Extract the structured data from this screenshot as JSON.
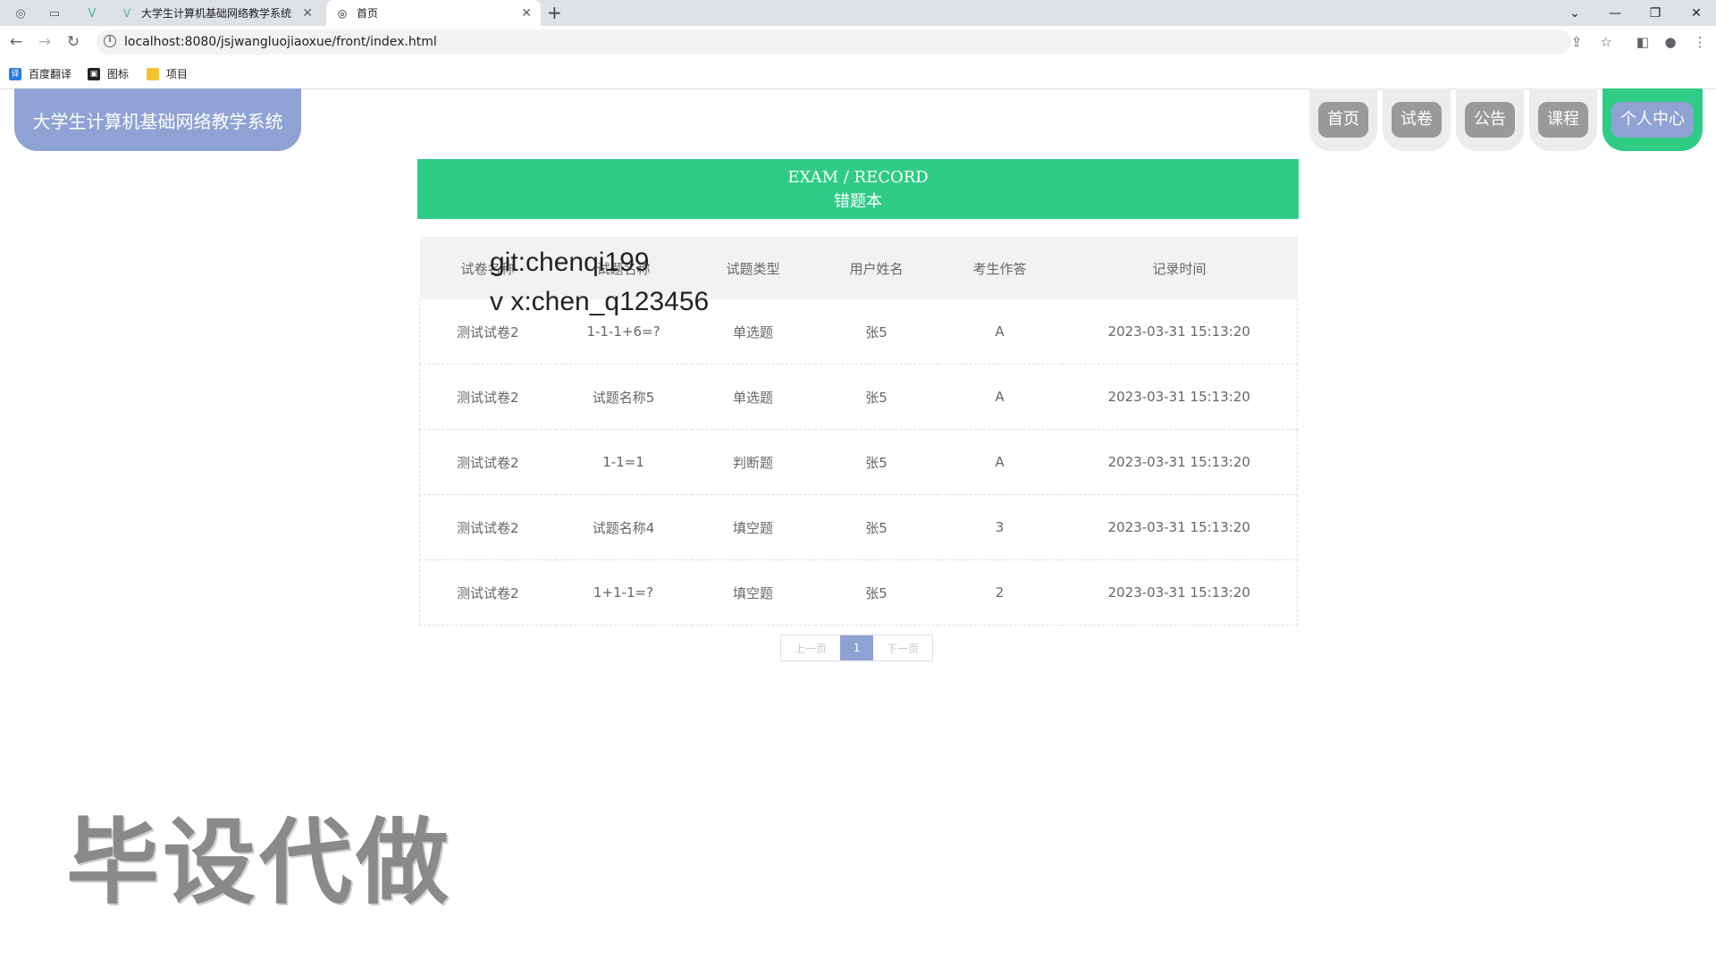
{
  "browser": {
    "tabs": [
      {
        "title": "大学生计算机基础网络教学系统",
        "active": false
      },
      {
        "title": "首页",
        "active": true
      }
    ],
    "url": "localhost:8080/jsjwangluojiaoxue/front/index.html",
    "bookmarks": [
      "百度翻译",
      "图标",
      "项目"
    ]
  },
  "site": {
    "logo_text": "大学生计算机基础网络教学系统",
    "nav": [
      "首页",
      "试卷",
      "公告",
      "课程",
      "个人中心"
    ],
    "active_nav": "个人中心"
  },
  "banner": {
    "title_en": "EXAM / RECORD",
    "title_zh": "错题本"
  },
  "table": {
    "columns": [
      "试卷名称",
      "试题名称",
      "试题类型",
      "用户姓名",
      "考生作答",
      "记录时间"
    ],
    "rows": [
      [
        "测试试卷2",
        "1-1-1+6=?",
        "单选题",
        "张5",
        "A",
        "2023-03-31 15:13:20"
      ],
      [
        "测试试卷2",
        "试题名称5",
        "单选题",
        "张5",
        "A",
        "2023-03-31 15:13:20"
      ],
      [
        "测试试卷2",
        "1-1=1",
        "判断题",
        "张5",
        "A",
        "2023-03-31 15:13:20"
      ],
      [
        "测试试卷2",
        "试题名称4",
        "填空题",
        "张5",
        "3",
        "2023-03-31 15:13:20"
      ],
      [
        "测试试卷2",
        "1+1-1=?",
        "填空题",
        "张5",
        "2",
        "2023-03-31 15:13:20"
      ]
    ]
  },
  "pagination": {
    "prev": "上一页",
    "current": "1",
    "next": "下一页"
  },
  "watermarks": {
    "line1": "git:chenqi199",
    "line2": "v x:chen_q123456",
    "big": "毕设代做"
  },
  "colors": {
    "accent_green": "#2ecc85",
    "accent_blue": "#8fa2d4"
  }
}
